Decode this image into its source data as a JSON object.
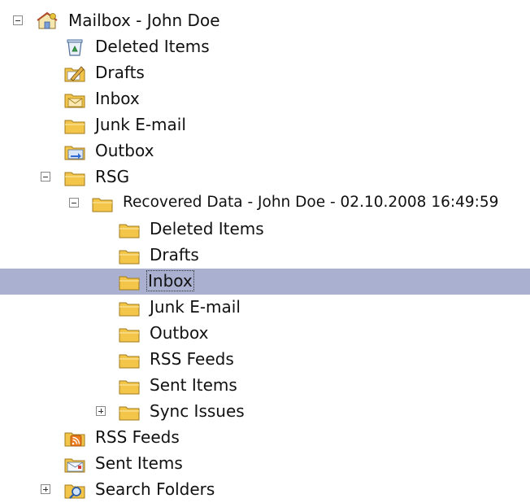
{
  "tree": {
    "mailbox": {
      "label": "Mailbox - John Doe",
      "icon": "mailbox-home-icon",
      "expanded": true
    },
    "deleted_items": {
      "label": "Deleted Items",
      "icon": "recycle-bin-icon"
    },
    "drafts": {
      "label": "Drafts",
      "icon": "drafts-folder-icon"
    },
    "inbox": {
      "label": "Inbox",
      "icon": "inbox-folder-icon"
    },
    "junk": {
      "label": "Junk E-mail",
      "icon": "folder-icon"
    },
    "outbox": {
      "label": "Outbox",
      "icon": "outbox-folder-icon"
    },
    "rsg": {
      "label": "RSG",
      "icon": "folder-icon",
      "expanded": true
    },
    "recovered": {
      "label": "Recovered Data - John Doe - 02.10.2008 16:49:59",
      "icon": "folder-icon",
      "expanded": true
    },
    "rec_deleted_items": {
      "label": "Deleted Items",
      "icon": "folder-icon"
    },
    "rec_drafts": {
      "label": "Drafts",
      "icon": "folder-icon"
    },
    "rec_inbox": {
      "label": "Inbox",
      "icon": "folder-icon",
      "selected": true
    },
    "rec_junk": {
      "label": "Junk E-mail",
      "icon": "folder-icon"
    },
    "rec_outbox": {
      "label": "Outbox",
      "icon": "folder-icon"
    },
    "rec_rss": {
      "label": "RSS Feeds",
      "icon": "folder-icon"
    },
    "rec_sent": {
      "label": "Sent Items",
      "icon": "folder-icon"
    },
    "rec_sync": {
      "label": "Sync Issues",
      "icon": "folder-icon",
      "expanded": false
    },
    "rss_feeds": {
      "label": "RSS Feeds",
      "icon": "rss-folder-icon"
    },
    "sent_items": {
      "label": "Sent Items",
      "icon": "sent-items-folder-icon"
    },
    "search_folders": {
      "label": "Search Folders",
      "icon": "search-folder-icon",
      "expanded": false
    }
  },
  "colors": {
    "selection": "#aab0cf",
    "folder": "#f3c64a"
  }
}
